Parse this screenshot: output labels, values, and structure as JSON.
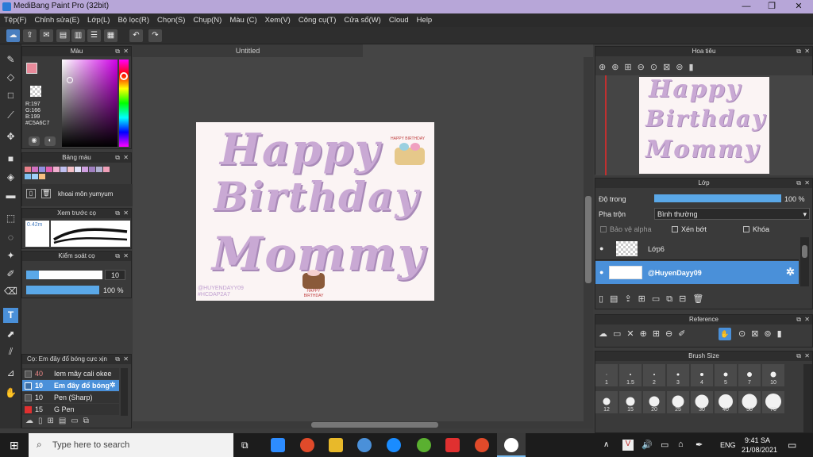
{
  "window": {
    "title": "MediBang Paint Pro (32bit)",
    "min": "—",
    "max": "❐",
    "close": "✕"
  },
  "menu": [
    "Tệp(F)",
    "Chỉnh sửa(E)",
    "Lớp(L)",
    "Bộ lọc(R)",
    "Chọn(S)",
    "Chụp(N)",
    "Màu (C)",
    "Xem(V)",
    "Công cụ(T)",
    "Cửa sổ(W)",
    "Cloud",
    "Help"
  ],
  "canvas_tab": "Untitled",
  "color_panel": {
    "title": "Màu",
    "r": "R:197",
    "g": "G:166",
    "b": "B:199",
    "hex": "#C5A6C7"
  },
  "palette_panel": {
    "title": "Bảng màu",
    "name": "khoai môn yumyum"
  },
  "brush_preview": {
    "title": "Xem trước cọ",
    "size": "0.42m"
  },
  "brush_control": {
    "title": "Kiểm soát cọ",
    "size_value": "10",
    "opacity_value": "100 %",
    "opacity": 100
  },
  "brush_list": {
    "title": "Cọ: Em đây đổ bóng cực xịn",
    "items": [
      {
        "size": "40",
        "name": "Iem mây cali okee",
        "color": "#555555"
      },
      {
        "size": "10",
        "name": "Em đây đổ bóng",
        "color": "#3b6ea5"
      },
      {
        "size": "10",
        "name": "Pen (Sharp)",
        "color": "#555555"
      },
      {
        "size": "15",
        "name": "G Pen",
        "color": "#e03030"
      }
    ]
  },
  "document": {
    "line1": "Happy",
    "line2": "Birthday",
    "line3": "Mommy",
    "sticker_text": "HAPPY BIRTHDAY",
    "watermark1": "@HUYENDAYY09",
    "watermark2": "#HCDAP2A7"
  },
  "navigator": {
    "title": "Hoa tiêu"
  },
  "layer_panel": {
    "title": "Lớp",
    "opacity_label": "Độ trong",
    "opacity_value": "100 %",
    "opacity": 100,
    "blend_label": "Pha trộn",
    "blend_value": "Bình thường",
    "protect_alpha": "Bảo vệ alpha",
    "clip": "Xén bớt",
    "lock": "Khóa",
    "layers": [
      {
        "name": "Lớp6",
        "selected": false
      },
      {
        "name": "@HuyenDayy09",
        "selected": true
      }
    ]
  },
  "reference": {
    "title": "Reference"
  },
  "brush_size": {
    "title": "Brush Size",
    "sizes": [
      "1",
      "1.5",
      "2",
      "3",
      "4",
      "5",
      "7",
      "10",
      "12",
      "15",
      "20",
      "25",
      "30",
      "40",
      "50",
      "70"
    ]
  },
  "taskbar": {
    "search_placeholder": "Type here to search",
    "time": "9:41 SA",
    "date": "21/08/2021",
    "lang": "ENG"
  },
  "colors": {
    "accent": "#4a90d9",
    "titlebar": "#b7a6d8",
    "text_purple": "#c9a9d4"
  }
}
